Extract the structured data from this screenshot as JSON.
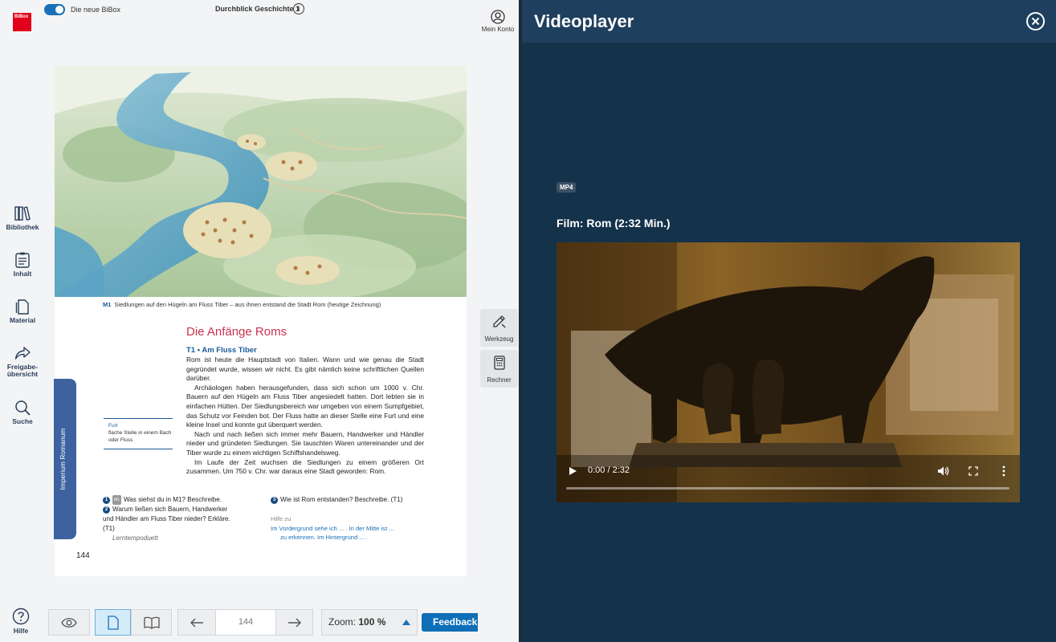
{
  "app": {
    "logo_text": "BiBox",
    "toggle_label": "Die neue BiBox",
    "book_title": "Durchblick Geschichte 1",
    "account_label": "Mein Konto"
  },
  "nav": {
    "items": [
      {
        "label": "Bibliothek",
        "icon": "library-icon"
      },
      {
        "label": "Inhalt",
        "icon": "contents-icon"
      },
      {
        "label": "Material",
        "icon": "material-icon"
      },
      {
        "label": "Freigabe-übersicht",
        "label_line1": "Freigabe-",
        "label_line2": "übersicht",
        "icon": "share-icon"
      },
      {
        "label": "Suche",
        "icon": "search-icon"
      }
    ],
    "help_label": "Hilfe"
  },
  "page": {
    "caption_label": "M1",
    "caption_text": "Siedlungen auf den Hügeln am Fluss Tiber – aus ihnen entstand die Stadt Rom (heutige Zeichnung)",
    "heading": "Die Anfänge Roms",
    "section": "T1  •  Am Fluss Tiber",
    "paragraphs": [
      "Rom ist heute die Hauptstadt von Italien. Wann und wie genau die Stadt gegründet wurde, wissen wir nicht. Es gibt nämlich keine schriftlichen Quellen darüber.",
      "Archäologen haben herausgefunden, dass sich schon um 1000 v. Chr. Bauern auf den Hügeln am Fluss Tiber angesiedelt hatten. Dort lebten sie in einfachen Hütten. Der Siedlungsbereich war umgeben von einem Sumpfgebiet, das Schutz vor Feinden bot. Der Fluss hatte an dieser Stelle eine Furt und eine kleine Insel und konnte gut überquert werden.",
      "Nach und nach ließen sich immer mehr Bauern, Handwerker und Händler nieder und gründeten Siedlungen. Sie tauschten Waren untereinander und der Tiber wurde zu einem wichtigen Schiffshandelsweg.",
      "Im Laufe der Zeit wuchsen die Siedlungen zu einem größeren Ort zusammen. Um 750 v. Chr. war daraus eine Stadt geworden: Rom."
    ],
    "glossary_term": "Furt",
    "glossary_def": "flache Stelle in einem Bach oder Fluss",
    "tab_label": "Imperium Romanum",
    "task1_num": "1",
    "task1_badge": "M1",
    "task1_text": "Was siehst du in M1? Beschreibe.",
    "task2_num": "2",
    "task2_text": "Warum ließen sich Bauern, Handwerker und Händler am Fluss Tiber nieder? Erkläre. (T1)",
    "task2_hint": "Lerntempoduett",
    "task3_num": "3",
    "task3_text": "Wie ist Rom entstanden? Beschreibe. (T1)",
    "hint_title": "Hilfe zu",
    "hint_line1": "Im Vordergrund sehe ich ... .  In der Mitte ist ...",
    "hint_line2": "zu erkennen.  Im Hintergrund ... .",
    "page_number": "144"
  },
  "tools": {
    "werkzeug": "Werkzeug",
    "rechner": "Rechner"
  },
  "toolbar": {
    "page_value": "144",
    "zoom_label": "Zoom:",
    "zoom_value": "100 %",
    "feedback": "Feedback"
  },
  "video": {
    "panel_title": "Videoplayer",
    "format_badge": "MP4",
    "film_title": "Film: Rom (2:32 Min.)",
    "time": "0:00 / 2:32",
    "progress": 0
  },
  "colors": {
    "accent": "#1a70b8",
    "heading_red": "#c8334f",
    "panel_bg": "#15324b",
    "panel_header": "#1e3f5d"
  }
}
